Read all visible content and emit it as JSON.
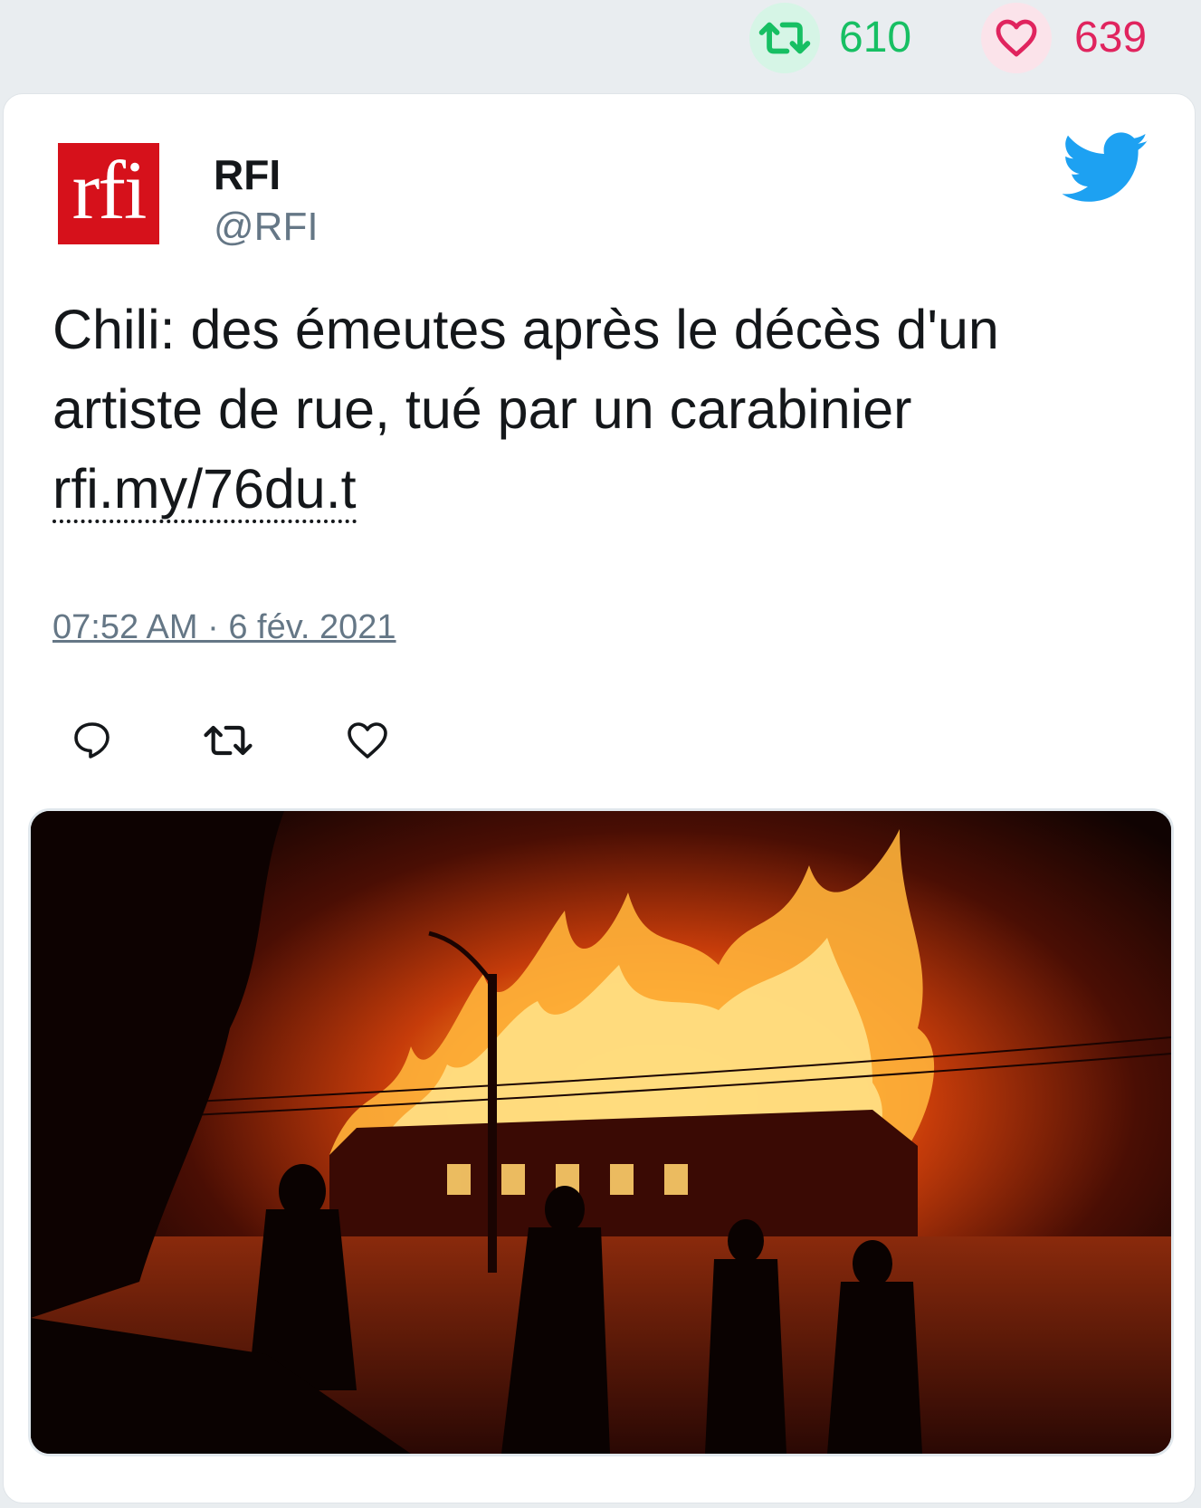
{
  "stats": {
    "retweet_count": "610",
    "like_count": "639",
    "retweet_icon": "retweet-icon",
    "like_icon": "heart-icon"
  },
  "tweet": {
    "author_name": "RFI",
    "author_handle": "@RFI",
    "avatar_logo": "rfi",
    "text": "Chili: des émeutes après le décès d'un artiste de rue, tué par un carabinier ",
    "link": "rfi.my/76du.t",
    "timestamp": "07:52 AM · 6 fév. 2021",
    "platform_icon": "twitter-bird-icon"
  },
  "actions": [
    "reply-icon",
    "retweet-icon",
    "heart-icon"
  ],
  "media": {
    "description_icon": "burning-building-photo"
  },
  "colors": {
    "retweet": "#17bf63",
    "like": "#e0245e",
    "twitter_blue": "#1da1f2",
    "rfi_red": "#d6111b",
    "secondary_text": "#657786"
  }
}
